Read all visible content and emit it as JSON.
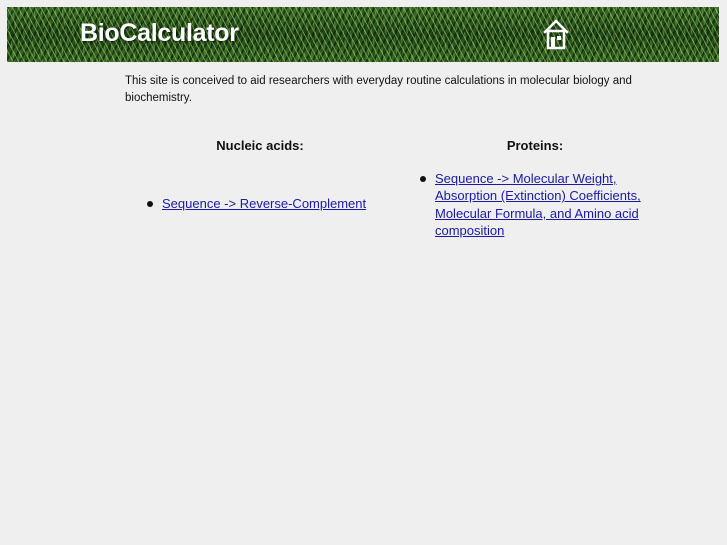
{
  "header": {
    "title": "BioCalculator",
    "home_icon": "home-icon",
    "background": "grass-texture"
  },
  "intro": {
    "text": "This site is conceived to aid researchers with everyday routine calculations in molecular biology and biochemistry."
  },
  "sections": {
    "nucleic": {
      "heading": "Nucleic acids:",
      "links": [
        {
          "label": "Sequence -> Reverse-Complement"
        }
      ]
    },
    "proteins": {
      "heading": "Proteins:",
      "links": [
        {
          "label": "Sequence -> Molecular Weight, Absorption (Extinction) Coefficients, Molecular Formula, and Amino acid composition"
        }
      ]
    }
  },
  "colors": {
    "page_background": "#efefef",
    "banner_green": "#2c5a1e",
    "title_text": "#ffffff",
    "link": "#1a1aa6",
    "body_text": "#111111"
  }
}
